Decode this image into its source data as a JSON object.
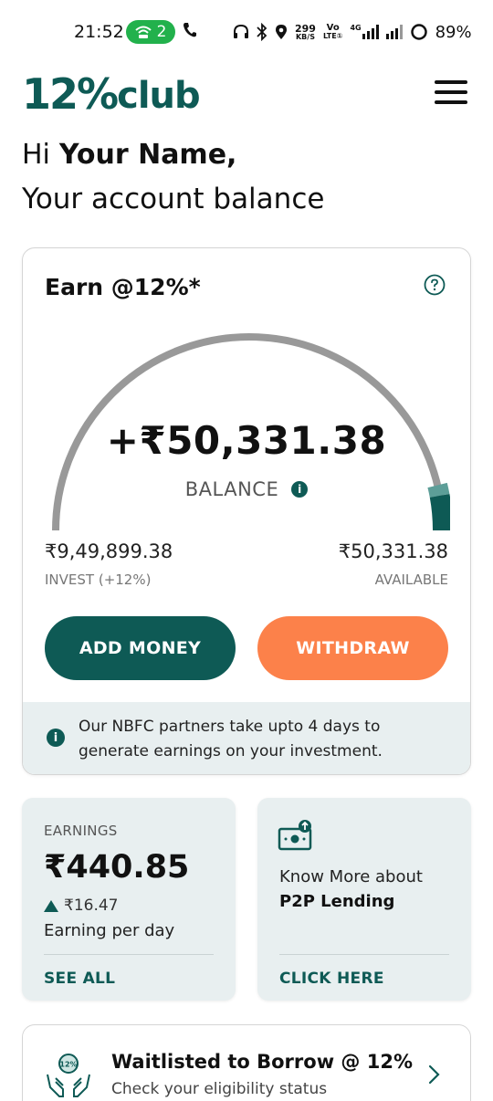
{
  "status_bar": {
    "time": "21:52",
    "hotspot_count": "2",
    "speed_value": "299",
    "speed_unit": "KB/S",
    "volte_top": "Vo",
    "volte_bottom": "LTE①",
    "network": "4G",
    "battery": "89%",
    "icons": [
      "wifi-hotspot-icon",
      "phone-icon",
      "headphones-icon",
      "bluetooth-icon",
      "location-icon",
      "signal-icon",
      "battery-icon"
    ]
  },
  "header": {
    "logo_number": "12%",
    "logo_text": "club"
  },
  "greeting": {
    "hi": "Hi",
    "name": "Your Name,",
    "subtitle": "Your account balance"
  },
  "earn_card": {
    "title": "Earn @12%*",
    "balance": "+₹50,331.38",
    "balance_label": "BALANCE",
    "invest_value": "₹9,49,899.38",
    "invest_label": "INVEST (+12%)",
    "available_value": "₹50,331.38",
    "available_label": "AVAILABLE",
    "add_money_label": "ADD MONEY",
    "withdraw_label": "WITHDRAW",
    "notice": "Our NBFC partners take upto 4 days to generate earnings on your investment.",
    "gauge_available_fraction": 0.05
  },
  "earnings_card": {
    "label": "EARNINGS",
    "amount": "₹440.85",
    "delta": "₹16.47",
    "sub": "Earning per day",
    "link": "SEE ALL"
  },
  "p2p_card": {
    "line1": "Know More about",
    "line2": "P2P Lending",
    "link": "CLICK HERE"
  },
  "borrow_card": {
    "title": "Waitlisted to Borrow @ 12%",
    "subtitle": "Check your eligibility status",
    "icon_text": "12%"
  },
  "colors": {
    "brand_green": "#0e5a55",
    "accent_orange": "#fc814a",
    "light_panel": "#e8eff0",
    "gauge_grey": "#999999",
    "gauge_light_teal": "#5d9e98"
  }
}
